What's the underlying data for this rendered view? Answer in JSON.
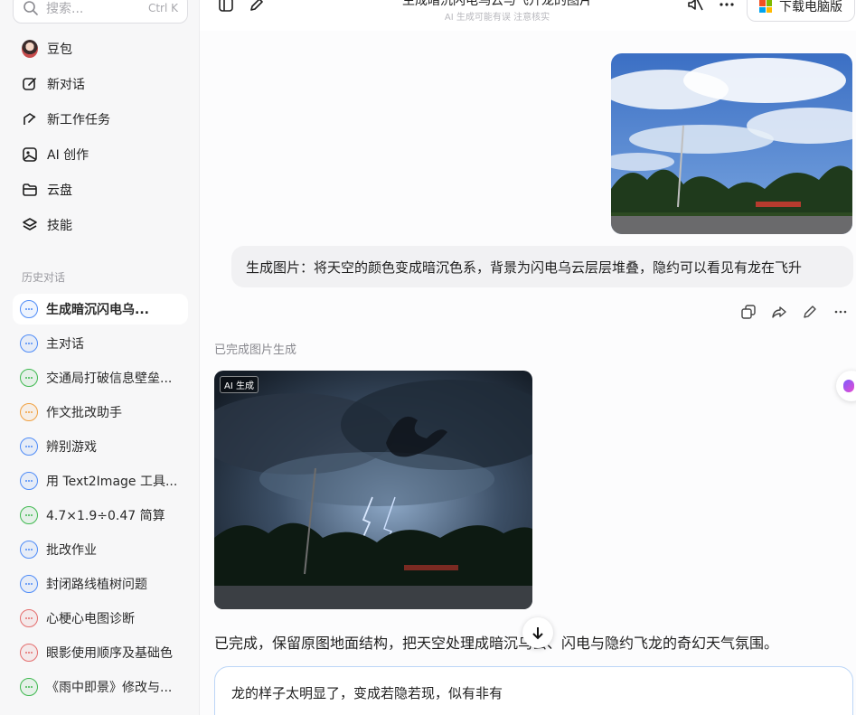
{
  "search": {
    "placeholder": "搜索...",
    "shortcut": "Ctrl K"
  },
  "nav": [
    {
      "label": "豆包",
      "icon": "avatar"
    },
    {
      "label": "新对话",
      "icon": "compose-icon"
    },
    {
      "label": "新工作任务",
      "icon": "task-icon"
    },
    {
      "label": "AI 创作",
      "icon": "image-icon"
    },
    {
      "label": "云盘",
      "icon": "folder-icon"
    },
    {
      "label": "技能",
      "icon": "layers-icon"
    }
  ],
  "history": {
    "title": "历史对话",
    "items": [
      {
        "label": "生成暗沉闪电乌...",
        "color": "#4f8cf7",
        "active": true
      },
      {
        "label": "主对话",
        "color": "#4f8cf7",
        "active": false
      },
      {
        "label": "交通局打破信息壁垒...",
        "color": "#3fb950",
        "active": false
      },
      {
        "label": "作文批改助手",
        "color": "#f0a040",
        "active": false
      },
      {
        "label": "辨别游戏",
        "color": "#4f8cf7",
        "active": false
      },
      {
        "label": "用 Text2Image 工具...",
        "color": "#4f8cf7",
        "active": false
      },
      {
        "label": "4.7×1.9÷0.47 简算",
        "color": "#3fb950",
        "active": false
      },
      {
        "label": "批改作业",
        "color": "#4f8cf7",
        "active": false
      },
      {
        "label": "封闭路线植树问题",
        "color": "#4f8cf7",
        "active": false
      },
      {
        "label": "心梗心电图诊断",
        "color": "#e46d6d",
        "active": false
      },
      {
        "label": "眼影使用顺序及基础色",
        "color": "#e46d6d",
        "active": false
      },
      {
        "label": "《雨中即景》修改与...",
        "color": "#3fb950",
        "active": false
      }
    ]
  },
  "header": {
    "title": "生成暗沉闪电乌云与飞升龙的图片",
    "subtitle": "AI 生成可能有误 注意核实",
    "download_label": "下载电脑版"
  },
  "chat": {
    "user_prompt": "生成图片：将天空的颜色变成暗沉色系，背景为闪电乌云层层堆叠，隐约可以看见有龙在飞升",
    "status": "已完成图片生成",
    "ai_tag": "AI 生成",
    "reply": "已完成，保留原图地面结构，把天空处理成暗沉乌云、闪电与隐约飞龙的奇幻天气氛围。",
    "input_value": "龙的样子太明显了，变成若隐若现，似有非有"
  }
}
